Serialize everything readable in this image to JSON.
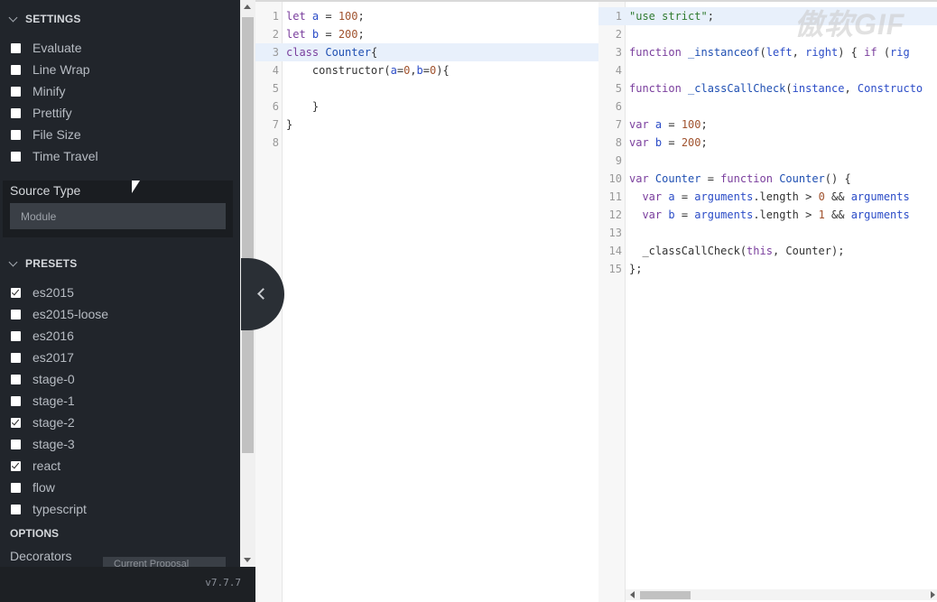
{
  "settings": {
    "title": "SETTINGS",
    "items": [
      {
        "label": "Evaluate",
        "checked": false
      },
      {
        "label": "Line Wrap",
        "checked": false
      },
      {
        "label": "Minify",
        "checked": false
      },
      {
        "label": "Prettify",
        "checked": false
      },
      {
        "label": "File Size",
        "checked": false
      },
      {
        "label": "Time Travel",
        "checked": false
      }
    ]
  },
  "source_type": {
    "label": "Source Type",
    "value": "Module"
  },
  "presets": {
    "title": "PRESETS",
    "items": [
      {
        "label": "es2015",
        "checked": true
      },
      {
        "label": "es2015-loose",
        "checked": false
      },
      {
        "label": "es2016",
        "checked": false
      },
      {
        "label": "es2017",
        "checked": false
      },
      {
        "label": "stage-0",
        "checked": false
      },
      {
        "label": "stage-1",
        "checked": false
      },
      {
        "label": "stage-2",
        "checked": true
      },
      {
        "label": "stage-3",
        "checked": false
      },
      {
        "label": "react",
        "checked": true
      },
      {
        "label": "flow",
        "checked": false
      },
      {
        "label": "typescript",
        "checked": false
      }
    ]
  },
  "options": {
    "title": "OPTIONS",
    "decorators_label": "Decorators",
    "decorators_value": "Current Proposal"
  },
  "version": "v7.7.7",
  "watermark": "傲软GIF",
  "input_code": {
    "active_line": 3,
    "lines": [
      [
        [
          "let ",
          "kw"
        ],
        [
          "a",
          "var"
        ],
        [
          " = ",
          "plain"
        ],
        [
          "100",
          "num"
        ],
        [
          ";",
          "plain"
        ]
      ],
      [
        [
          "let ",
          "kw"
        ],
        [
          "b",
          "var"
        ],
        [
          " = ",
          "plain"
        ],
        [
          "200",
          "num"
        ],
        [
          ";",
          "plain"
        ]
      ],
      [
        [
          "class ",
          "kw"
        ],
        [
          "Counter",
          "cls"
        ],
        [
          "{",
          "plain"
        ]
      ],
      [
        [
          "    constructor(",
          "plain"
        ],
        [
          "a",
          "var"
        ],
        [
          "=",
          "plain"
        ],
        [
          "0",
          "num"
        ],
        [
          ",",
          "plain"
        ],
        [
          "b",
          "var"
        ],
        [
          "=",
          "plain"
        ],
        [
          "0",
          "num"
        ],
        [
          "){",
          "plain"
        ]
      ],
      [
        [
          "",
          "plain"
        ]
      ],
      [
        [
          "    }",
          "plain"
        ]
      ],
      [
        [
          "}",
          "plain"
        ]
      ],
      [
        [
          "",
          "plain"
        ]
      ]
    ]
  },
  "output_code": {
    "active_line": 1,
    "lines": [
      [
        [
          "\"use strict\"",
          "str"
        ],
        [
          ";",
          "plain"
        ]
      ],
      [
        [
          "",
          "plain"
        ]
      ],
      [
        [
          "function ",
          "kw"
        ],
        [
          "_instanceof",
          "cls"
        ],
        [
          "(",
          "plain"
        ],
        [
          "left",
          "var"
        ],
        [
          ", ",
          "plain"
        ],
        [
          "right",
          "var"
        ],
        [
          ") { ",
          "plain"
        ],
        [
          "if",
          "kw"
        ],
        [
          " (",
          "plain"
        ],
        [
          "rig",
          "var"
        ]
      ],
      [
        [
          "",
          "plain"
        ]
      ],
      [
        [
          "function ",
          "kw"
        ],
        [
          "_classCallCheck",
          "cls"
        ],
        [
          "(",
          "plain"
        ],
        [
          "instance",
          "var"
        ],
        [
          ", ",
          "plain"
        ],
        [
          "Constructo",
          "var"
        ]
      ],
      [
        [
          "",
          "plain"
        ]
      ],
      [
        [
          "var ",
          "kw"
        ],
        [
          "a",
          "var"
        ],
        [
          " = ",
          "plain"
        ],
        [
          "100",
          "num"
        ],
        [
          ";",
          "plain"
        ]
      ],
      [
        [
          "var ",
          "kw"
        ],
        [
          "b",
          "var"
        ],
        [
          " = ",
          "plain"
        ],
        [
          "200",
          "num"
        ],
        [
          ";",
          "plain"
        ]
      ],
      [
        [
          "",
          "plain"
        ]
      ],
      [
        [
          "var ",
          "kw"
        ],
        [
          "Counter",
          "cls"
        ],
        [
          " = ",
          "plain"
        ],
        [
          "function ",
          "kw"
        ],
        [
          "Counter",
          "cls"
        ],
        [
          "() {",
          "plain"
        ]
      ],
      [
        [
          "  ",
          "plain"
        ],
        [
          "var ",
          "kw"
        ],
        [
          "a",
          "var"
        ],
        [
          " = ",
          "plain"
        ],
        [
          "arguments",
          "var"
        ],
        [
          ".length > ",
          "plain"
        ],
        [
          "0",
          "num"
        ],
        [
          " && ",
          "plain"
        ],
        [
          "arguments",
          "var"
        ]
      ],
      [
        [
          "  ",
          "plain"
        ],
        [
          "var ",
          "kw"
        ],
        [
          "b",
          "var"
        ],
        [
          " = ",
          "plain"
        ],
        [
          "arguments",
          "var"
        ],
        [
          ".length > ",
          "plain"
        ],
        [
          "1",
          "num"
        ],
        [
          " && ",
          "plain"
        ],
        [
          "arguments",
          "var"
        ]
      ],
      [
        [
          "",
          "plain"
        ]
      ],
      [
        [
          "  _classCallCheck(",
          "plain"
        ],
        [
          "this",
          "kw"
        ],
        [
          ", Counter);",
          "plain"
        ]
      ],
      [
        [
          "};",
          "plain"
        ]
      ]
    ]
  }
}
